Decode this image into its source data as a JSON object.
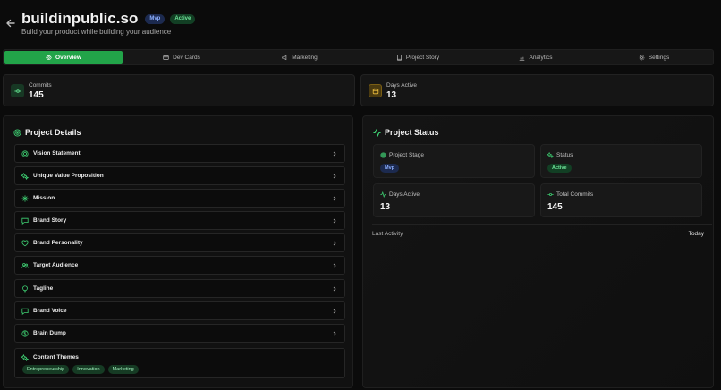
{
  "header": {
    "title": "buildinpublic.so",
    "badges": [
      "Mvp",
      "Active"
    ],
    "subtitle": "Build your product while building your audience"
  },
  "tabs": [
    {
      "label": "Overview",
      "icon": "eye-icon",
      "active": true
    },
    {
      "label": "Dev Cards",
      "icon": "card-icon",
      "active": false
    },
    {
      "label": "Marketing",
      "icon": "megaphone-icon",
      "active": false
    },
    {
      "label": "Project Story",
      "icon": "book-icon",
      "active": false
    },
    {
      "label": "Analytics",
      "icon": "bar-chart-icon",
      "active": false
    },
    {
      "label": "Settings",
      "icon": "gear-icon",
      "active": false
    }
  ],
  "stats": {
    "commits": {
      "label": "Commits",
      "value": "145",
      "icon": "git-commit-icon"
    },
    "days_active": {
      "label": "Days Active",
      "value": "13",
      "icon": "calendar-icon"
    }
  },
  "project_details": {
    "title": "Project Details",
    "items": [
      {
        "label": "Vision Statement",
        "icon": "target-icon"
      },
      {
        "label": "Unique Value Proposition",
        "icon": "sparkles-icon"
      },
      {
        "label": "Mission",
        "icon": "compass-icon"
      },
      {
        "label": "Brand Story",
        "icon": "message-icon"
      },
      {
        "label": "Brand Personality",
        "icon": "heart-icon"
      },
      {
        "label": "Target Audience",
        "icon": "users-icon"
      },
      {
        "label": "Tagline",
        "icon": "lightbulb-icon"
      },
      {
        "label": "Brand Voice",
        "icon": "chat-icon"
      },
      {
        "label": "Brain Dump",
        "icon": "brain-icon"
      }
    ],
    "content_themes": {
      "label": "Content Themes",
      "tags": [
        "Entrepreneurship",
        "Innovation",
        "Marketing"
      ]
    }
  },
  "project_status": {
    "title": "Project Status",
    "stage": {
      "label": "Project Stage",
      "value": "Mvp"
    },
    "status": {
      "label": "Status",
      "value": "Active"
    },
    "days_active": {
      "label": "Days Active",
      "value": "13"
    },
    "total_commits": {
      "label": "Total Commits",
      "value": "145"
    },
    "last_activity": {
      "label": "Last Activity",
      "value": "Today"
    }
  },
  "colors": {
    "accent": "#22a449",
    "background": "#0b0b0b",
    "panel": "#111111",
    "badge_mvp": "#1c2a4f",
    "badge_active": "#123f24"
  }
}
